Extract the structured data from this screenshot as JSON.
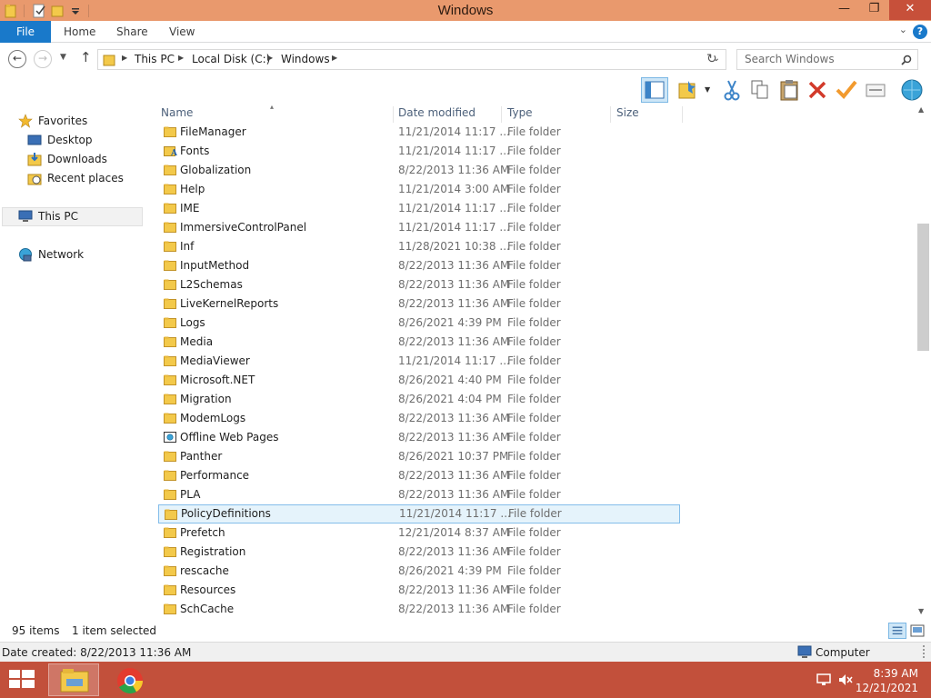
{
  "window": {
    "title": "Windows"
  },
  "title_buttons": {
    "minimize": "—",
    "maximize": "❐",
    "close": "✕"
  },
  "ribbon": {
    "tabs": [
      "File",
      "Home",
      "Share",
      "View"
    ],
    "help_label": "?",
    "collapse_glyph": "⌄"
  },
  "address": {
    "crumbs": [
      "This PC",
      "Local Disk (C:)",
      "Windows"
    ],
    "search_placeholder": "Search Windows"
  },
  "nav": {
    "favorites": "Favorites",
    "desktop": "Desktop",
    "downloads": "Downloads",
    "recent": "Recent places",
    "this_pc": "This PC",
    "network": "Network"
  },
  "columns": {
    "name": "Name",
    "date": "Date modified",
    "type": "Type",
    "size": "Size"
  },
  "files": [
    {
      "name": "FileManager",
      "date": "11/21/2014 11:17 ...",
      "type": "File folder",
      "icon": "folder"
    },
    {
      "name": "Fonts",
      "date": "11/21/2014 11:17 ...",
      "type": "File folder",
      "icon": "fonts-folder"
    },
    {
      "name": "Globalization",
      "date": "8/22/2013 11:36 AM",
      "type": "File folder",
      "icon": "folder"
    },
    {
      "name": "Help",
      "date": "11/21/2014 3:00 AM",
      "type": "File folder",
      "icon": "folder"
    },
    {
      "name": "IME",
      "date": "11/21/2014 11:17 ...",
      "type": "File folder",
      "icon": "folder"
    },
    {
      "name": "ImmersiveControlPanel",
      "date": "11/21/2014 11:17 ...",
      "type": "File folder",
      "icon": "folder"
    },
    {
      "name": "Inf",
      "date": "11/28/2021 10:38 ...",
      "type": "File folder",
      "icon": "folder"
    },
    {
      "name": "InputMethod",
      "date": "8/22/2013 11:36 AM",
      "type": "File folder",
      "icon": "folder"
    },
    {
      "name": "L2Schemas",
      "date": "8/22/2013 11:36 AM",
      "type": "File folder",
      "icon": "folder"
    },
    {
      "name": "LiveKernelReports",
      "date": "8/22/2013 11:36 AM",
      "type": "File folder",
      "icon": "folder"
    },
    {
      "name": "Logs",
      "date": "8/26/2021 4:39 PM",
      "type": "File folder",
      "icon": "folder"
    },
    {
      "name": "Media",
      "date": "8/22/2013 11:36 AM",
      "type": "File folder",
      "icon": "folder"
    },
    {
      "name": "MediaViewer",
      "date": "11/21/2014 11:17 ...",
      "type": "File folder",
      "icon": "folder"
    },
    {
      "name": "Microsoft.NET",
      "date": "8/26/2021 4:40 PM",
      "type": "File folder",
      "icon": "folder"
    },
    {
      "name": "Migration",
      "date": "8/26/2021 4:04 PM",
      "type": "File folder",
      "icon": "folder"
    },
    {
      "name": "ModemLogs",
      "date": "8/22/2013 11:36 AM",
      "type": "File folder",
      "icon": "folder"
    },
    {
      "name": "Offline Web Pages",
      "date": "8/22/2013 11:36 AM",
      "type": "File folder",
      "icon": "offline-web-pages-folder"
    },
    {
      "name": "Panther",
      "date": "8/26/2021 10:37 PM",
      "type": "File folder",
      "icon": "folder"
    },
    {
      "name": "Performance",
      "date": "8/22/2013 11:36 AM",
      "type": "File folder",
      "icon": "folder"
    },
    {
      "name": "PLA",
      "date": "8/22/2013 11:36 AM",
      "type": "File folder",
      "icon": "folder"
    },
    {
      "name": "PolicyDefinitions",
      "date": "11/21/2014 11:17 ...",
      "type": "File folder",
      "icon": "folder",
      "selected": true
    },
    {
      "name": "Prefetch",
      "date": "12/21/2014 8:37 AM",
      "type": "File folder",
      "icon": "folder"
    },
    {
      "name": "Registration",
      "date": "8/22/2013 11:36 AM",
      "type": "File folder",
      "icon": "folder"
    },
    {
      "name": "rescache",
      "date": "8/26/2021 4:39 PM",
      "type": "File folder",
      "icon": "folder"
    },
    {
      "name": "Resources",
      "date": "8/22/2013 11:36 AM",
      "type": "File folder",
      "icon": "folder"
    },
    {
      "name": "SchCache",
      "date": "8/22/2013 11:36 AM",
      "type": "File folder",
      "icon": "folder"
    }
  ],
  "status": {
    "items": "95 items",
    "selection": "1 item selected"
  },
  "details": {
    "created": "Date created: 8/22/2013 11:36 AM",
    "location": "Computer"
  },
  "taskbar": {
    "time": "8:39 AM",
    "date": "12/21/2021"
  },
  "colors": {
    "accent": "#1979ca",
    "titlebar": "#e9996d",
    "taskbar": "#c2503b",
    "selection_bg": "#e5f3fb",
    "selection_border": "#84bdea"
  }
}
